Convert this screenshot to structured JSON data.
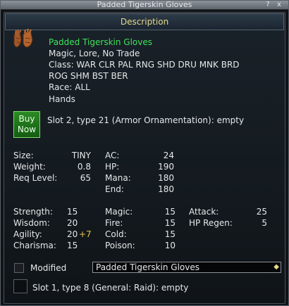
{
  "window": {
    "title": "Padded Tigerskin Gloves",
    "help_label": "?",
    "close_label": "x"
  },
  "description": {
    "header": "Description",
    "item_name": "Padded Tigerskin Gloves",
    "flags": "Magic, Lore, No Trade",
    "class_line_1": "Class: WAR CLR PAL RNG SHD DRU MNK BRD",
    "class_line_2": "ROG SHM BST BER",
    "race": "Race: ALL",
    "slot": "Hands"
  },
  "buy_button": {
    "line1": "Buy",
    "line2": "Now"
  },
  "augment_slot_2": "Slot 2, type 21 (Armor Ornamentation): empty",
  "stats_col1": [
    {
      "label": "Size:",
      "value": "TINY"
    },
    {
      "label": "Weight:",
      "value": "0.8"
    },
    {
      "label": "Req Level:",
      "value": "65"
    }
  ],
  "stats_col2": [
    {
      "label": "AC:",
      "value": "24"
    },
    {
      "label": "HP:",
      "value": "190"
    },
    {
      "label": "Mana:",
      "value": "180"
    },
    {
      "label": "End:",
      "value": "180"
    }
  ],
  "attr_col1": [
    {
      "label": "Strength:",
      "value": "15"
    },
    {
      "label": "Wisdom:",
      "value": "20"
    },
    {
      "label": "Agility:",
      "value": "20",
      "bonus": "+7"
    },
    {
      "label": "Charisma:",
      "value": "15"
    }
  ],
  "attr_col2": [
    {
      "label": "Magic:",
      "value": "15"
    },
    {
      "label": "Fire:",
      "value": "15"
    },
    {
      "label": "Cold:",
      "value": "15"
    },
    {
      "label": "Poison:",
      "value": "10"
    }
  ],
  "attr_col3": [
    {
      "label": "Attack:",
      "value": "25"
    },
    {
      "label": "HP Regen:",
      "value": "5"
    }
  ],
  "modified": {
    "label": "Modified",
    "checked": false
  },
  "appearance_select": {
    "selected": "Padded Tigerskin Gloves"
  },
  "augment_slot_1": "Slot 1, type 8 (General: Raid): empty",
  "colors": {
    "item_name": "#3fe25c",
    "header_text": "#e7d98a",
    "bonus": "#e6c34a"
  }
}
